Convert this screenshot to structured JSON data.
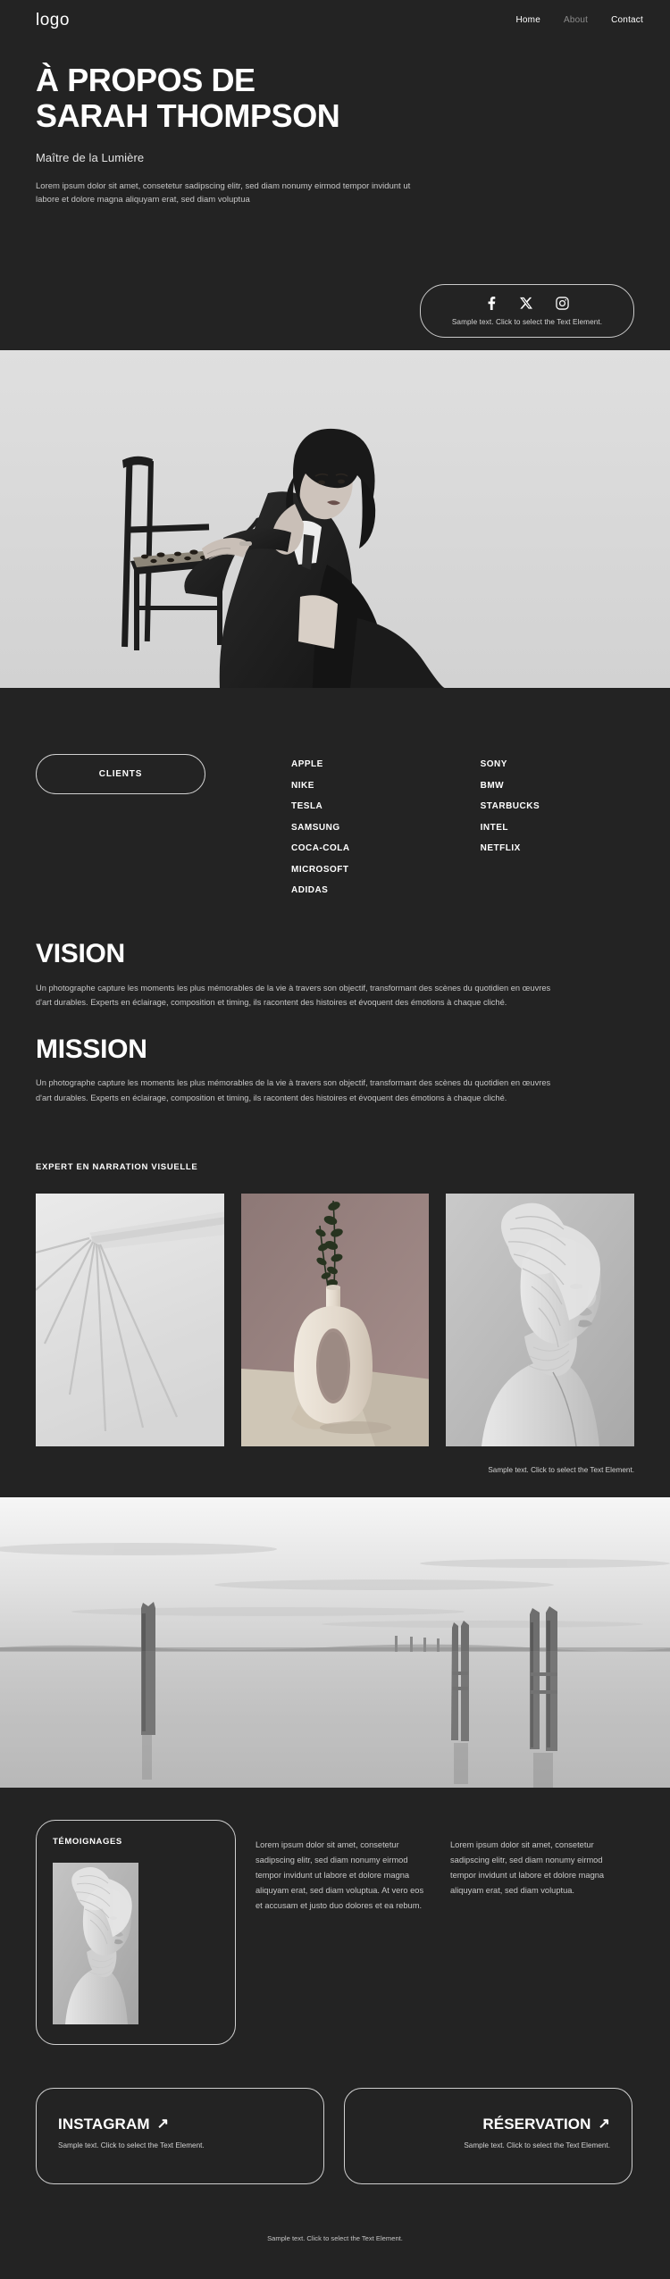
{
  "header": {
    "logo": "logo",
    "nav": [
      {
        "label": "Home",
        "state": "normal"
      },
      {
        "label": "About",
        "state": "muted"
      },
      {
        "label": "Contact",
        "state": "normal"
      }
    ]
  },
  "hero": {
    "title_line1": "À PROPOS DE",
    "title_line2": "SARAH THOMPSON",
    "subtitle": "Maître de la Lumière",
    "description": "Lorem ipsum dolor sit amet, consetetur sadipscing elitr, sed diam nonumy eirmod tempor invidunt ut labore et dolore magna aliquyam erat, sed diam voluptua",
    "social": {
      "icons": [
        "facebook-icon",
        "x-twitter-icon",
        "instagram-icon"
      ],
      "caption": "Sample text. Click to select the Text Element."
    }
  },
  "portrait": {
    "alt": "black-and-white portrait of a woman in a dark blazer leaning on a wooden chair"
  },
  "clients": {
    "pill_label": "CLIENTS",
    "column_left": [
      "APPLE",
      "NIKE",
      "TESLA",
      "SAMSUNG",
      "COCA-COLA",
      "MICROSOFT",
      "ADIDAS"
    ],
    "column_right": [
      "SONY",
      "BMW",
      "STARBUCKS",
      "INTEL",
      "NETFLIX"
    ]
  },
  "statements": [
    {
      "title": "VISION",
      "body": "Un photographe capture les moments les plus mémorables de la vie à travers son objectif, transformant des scènes du quotidien en œuvres d'art durables. Experts en éclairage, composition et timing, ils racontent des histoires et évoquent des émotions à chaque cliché."
    },
    {
      "title": "MISSION",
      "body": "Un photographe capture les moments les plus mémorables de la vie à travers son objectif, transformant des scènes du quotidien en œuvres d'art durables. Experts en éclairage, composition et timing, ils racontent des histoires et évoquent des émotions à chaque cliché."
    }
  ],
  "gallery": {
    "label": "EXPERT EN NARRATION VISUELLE",
    "items": [
      {
        "alt": "minimal white architecture with radiating shadow lines"
      },
      {
        "alt": "cream oval ceramic vase with dried eucalyptus on mauve backdrop"
      },
      {
        "alt": "monochrome sculpture bust wrapped in translucent fabric"
      }
    ],
    "caption": "Sample text. Click to select the Text Element."
  },
  "landscape": {
    "alt": "long-exposure black and white seascape with wooden mooring posts"
  },
  "testimonials": {
    "card_title": "TÉMOIGNAGES",
    "photo_alt": "monochrome sculpture bust wrapped in translucent fabric",
    "columns": [
      "Lorem ipsum dolor sit amet, consetetur sadipscing elitr, sed diam nonumy eirmod tempor invidunt ut labore et dolore magna aliquyam erat, sed diam voluptua. At vero eos et accusam et justo duo dolores et ea rebum.",
      "Lorem ipsum dolor sit amet, consetetur sadipscing elitr, sed diam nonumy eirmod tempor invidunt ut labore et dolore magna aliquyam erat, sed diam voluptua."
    ]
  },
  "cta": [
    {
      "title": "INSTAGRAM",
      "arrow": "↗",
      "subtitle": "Sample text. Click to select the Text Element."
    },
    {
      "title": "RÉSERVATION",
      "arrow": "↗",
      "subtitle": "Sample text. Click to select the Text Element."
    }
  ],
  "footer": {
    "text": "Sample text. Click to select the Text Element."
  },
  "colors": {
    "background": "#232323",
    "text": "#ffffff",
    "muted_text": "#c6c6c6",
    "border": "#cfcfcf"
  }
}
